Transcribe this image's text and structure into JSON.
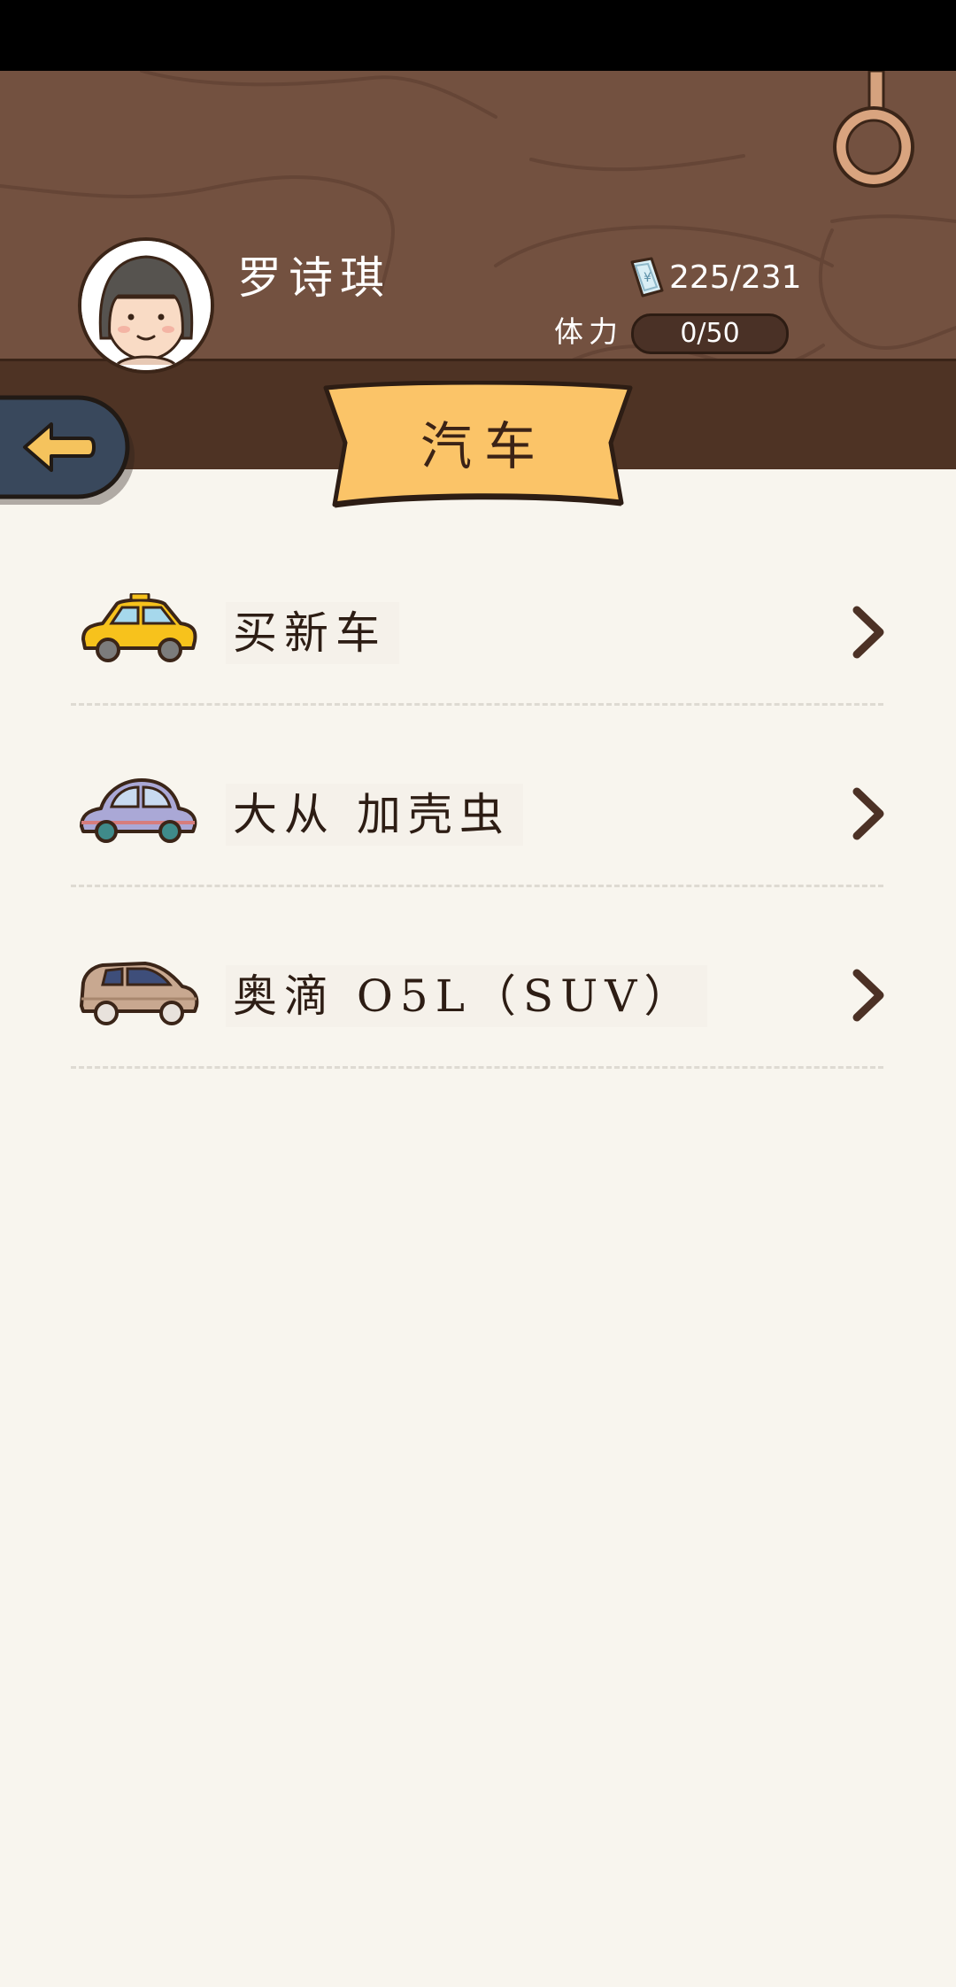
{
  "player": {
    "name": "罗诗琪",
    "money": "225/231",
    "stamina_label": "体力",
    "stamina_value": "0/50",
    "stamina_fraction": 0
  },
  "page": {
    "title": "汽车"
  },
  "menu": {
    "items": [
      {
        "label": "买新车",
        "car_icon": "yellow-car-icon",
        "car_color": "#f7c21c"
      },
      {
        "label": "大从 加壳虫",
        "car_icon": "lilac-beetle-car-icon",
        "car_color": "#aaa8d6"
      },
      {
        "label": "奥滴 O5L（SUV）",
        "car_icon": "beige-suv-car-icon",
        "car_color": "#c8a890"
      }
    ]
  },
  "colors": {
    "header_wood": "#735140",
    "banner": "#fbc468",
    "back_button": "#39485c",
    "back_arrow": "#f5c35d",
    "page_background": "#f8f5ee",
    "text_dark": "#2d1d14"
  },
  "icons": {
    "back": "back-arrow-icon",
    "money": "money-bill-icon",
    "ring": "hanging-ring-icon",
    "chevron": "chevron-right-icon"
  }
}
